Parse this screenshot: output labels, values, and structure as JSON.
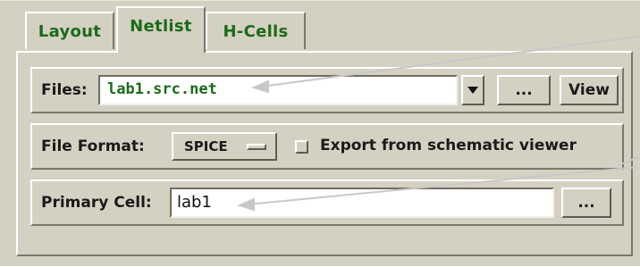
{
  "tabs": [
    {
      "label": "Layout",
      "active": false
    },
    {
      "label": "Netlist",
      "active": true
    },
    {
      "label": "H-Cells",
      "active": false
    }
  ],
  "files": {
    "label": "Files:",
    "value": "lab1.src.net",
    "browse_label": "...",
    "view_label": "View",
    "dropdown_icon": "chevron-down-icon"
  },
  "file_format": {
    "label": "File Format:",
    "selected": "SPICE",
    "export_checkbox_label": "Export from schematic viewer",
    "export_checked": false
  },
  "primary_cell": {
    "label": "Primary Cell:",
    "value": "lab1",
    "browse_label": "..."
  },
  "colors": {
    "background": "#d5d1c2",
    "accent_text": "#1a6b1a",
    "input_background": "#ffffff",
    "callout_line": "#c8c8c8"
  }
}
